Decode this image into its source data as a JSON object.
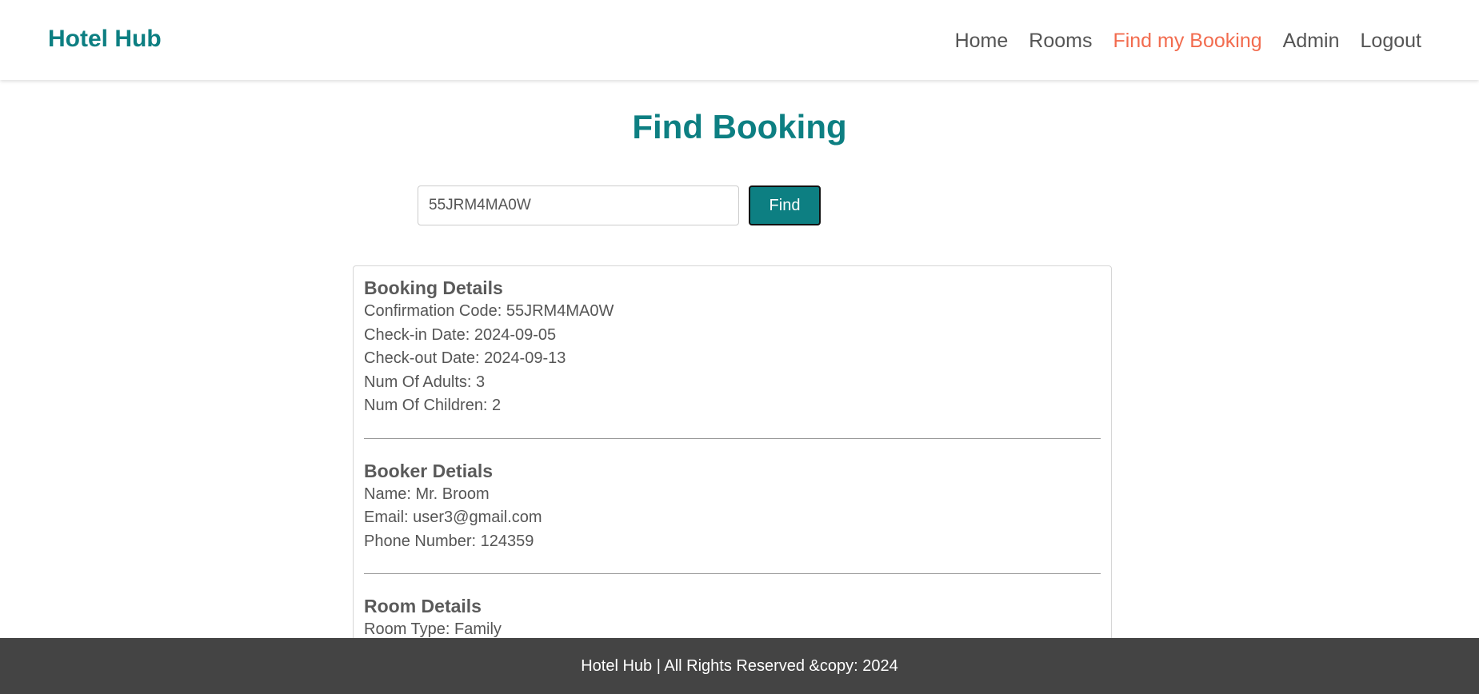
{
  "nav": {
    "brand": "Hotel Hub",
    "links": [
      "Home",
      "Rooms",
      "Find my Booking",
      "Admin",
      "Logout"
    ],
    "active_link": "Find my Booking"
  },
  "page": {
    "title": "Find Booking"
  },
  "search": {
    "value": "55JRM4MA0W",
    "button_label": "Find"
  },
  "booking_details": {
    "title": "Booking Details",
    "lines": [
      "Confirmation Code: 55JRM4MA0W",
      "Check-in Date: 2024-09-05",
      "Check-out Date: 2024-09-13",
      "Num Of Adults: 3",
      "Num Of Children: 2"
    ]
  },
  "booker_details": {
    "title": "Booker Detials",
    "lines": [
      "Name: Mr. Broom",
      "Email: user3@gmail.com",
      "Phone Number: 124359"
    ]
  },
  "room_details": {
    "title": "Room Details",
    "lines": [
      "Room Type: Family"
    ]
  },
  "footer": {
    "text": "Hotel Hub | All Rights Reserved &copy: 2024"
  },
  "colors": {
    "brand": "#0d7f82",
    "active_link": "#f26c4f",
    "footer_bg": "#444444"
  }
}
